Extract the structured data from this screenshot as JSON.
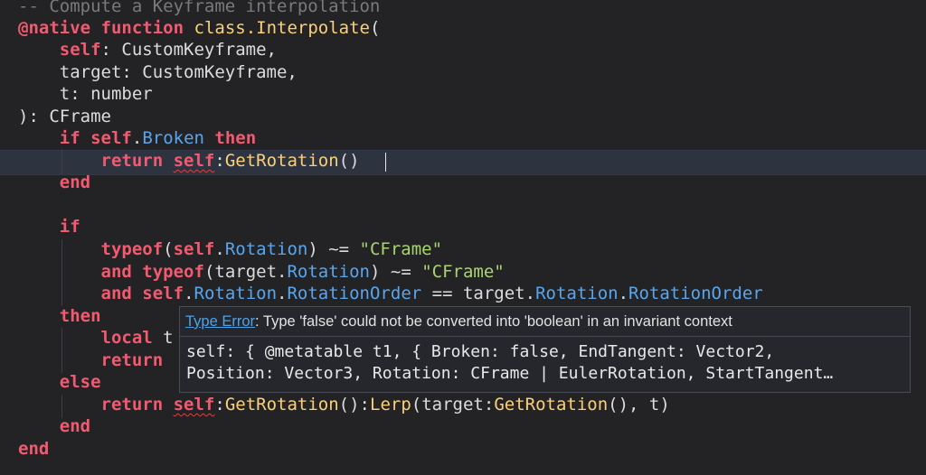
{
  "code": {
    "comment": "-- Compute a Keyframe interpolation",
    "kw_native": "@native",
    "kw_function": "function",
    "fn_decl": "class.Interpolate",
    "paren_open": "(",
    "p_self": "self",
    "p_self_type": ": CustomKeyframe,",
    "p_target": "target: CustomKeyframe,",
    "p_t": "t: number",
    "ret_type": "): CFrame",
    "kw_if": "if",
    "kw_self": "self",
    "dot": ".",
    "broken": "Broken",
    "kw_then": "then",
    "kw_return": "return",
    "colon": ":",
    "get_rotation": "GetRotation",
    "call_empty": "()",
    "kw_end": "end",
    "typeof": "typeof",
    "open_paren": "(",
    "rotation": "Rotation",
    "neq_cframe": ") ~= ",
    "str_cframe": "\"CFrame\"",
    "kw_and": "and",
    "target": "target",
    "rotation_order": "RotationOrder",
    "eq": " == ",
    "kw_local": "local",
    "local_rest": "t",
    "kw_else": "else",
    "lerp": "Lerp",
    "lerp_args_tail": "(), t)",
    "call_close_colon": "():"
  },
  "tooltip": {
    "error_link": "Type Error",
    "message": ": Type 'false' could not be converted into 'boolean' in an invariant context",
    "detail_line1": "self: { @metatable t1, { Broken: false, EndTangent: Vector2,",
    "detail_line2": "Position: Vector3, Rotation: CFrame | EulerRotation, StartTangent…"
  }
}
